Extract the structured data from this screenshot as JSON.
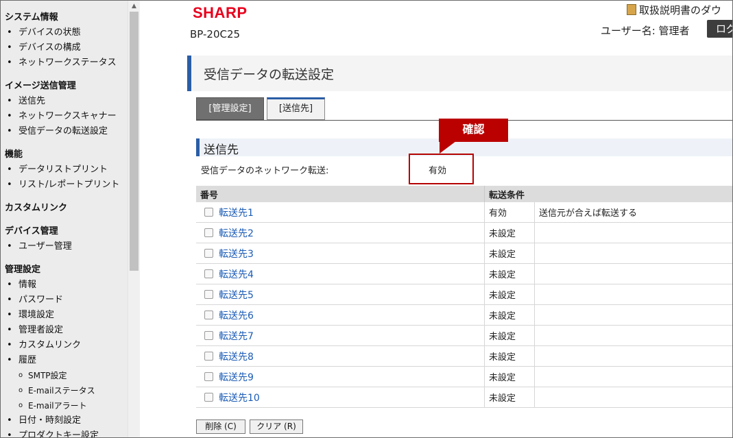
{
  "sidebar": {
    "sections": [
      {
        "title": "システム情報",
        "items": [
          {
            "label": "デバイスの状態"
          },
          {
            "label": "デバイスの構成"
          },
          {
            "label": "ネットワークステータス"
          }
        ]
      },
      {
        "title": "イメージ送信管理",
        "items": [
          {
            "label": "送信先"
          },
          {
            "label": "ネットワークスキャナー"
          },
          {
            "label": "受信データの転送設定"
          }
        ]
      },
      {
        "title": "機能",
        "items": [
          {
            "label": "データリストプリント"
          },
          {
            "label": "リスト/レポートプリント"
          }
        ]
      },
      {
        "title": "カスタムリンク",
        "items": []
      },
      {
        "title": "デバイス管理",
        "items": [
          {
            "label": "ユーザー管理"
          }
        ]
      },
      {
        "title": "管理設定",
        "items": [
          {
            "label": "情報"
          },
          {
            "label": "パスワード"
          },
          {
            "label": "環境設定"
          },
          {
            "label": "管理者設定"
          },
          {
            "label": "カスタムリンク"
          },
          {
            "label": "履歴"
          }
        ]
      }
    ],
    "history_subitems": [
      {
        "label": "SMTP設定"
      },
      {
        "label": "E-mailステータス"
      },
      {
        "label": "E-mailアラート"
      }
    ],
    "tail_items": [
      {
        "label": "日付・時刻設定"
      },
      {
        "label": "プロダクトキー設定"
      }
    ]
  },
  "header": {
    "logo": "SHARP",
    "model": "BP-20C25",
    "manual_link": "取扱説明書のダウ",
    "user_label": "ユーザー名: 管理者",
    "logout_label": "ログ"
  },
  "page_title": "受信データの転送設定",
  "tabs": {
    "admin": "[管理設定]",
    "destination": "[送信先]"
  },
  "section": {
    "title": "送信先",
    "network_transfer_label": "受信データのネットワーク転送:",
    "network_transfer_value": "有効"
  },
  "callout": "確認",
  "table": {
    "headers": {
      "number": "番号",
      "condition": "転送条件"
    },
    "rows": [
      {
        "name": "転送先1",
        "status": "有効",
        "condition": "送信元が合えば転送する"
      },
      {
        "name": "転送先2",
        "status": "未設定",
        "condition": ""
      },
      {
        "name": "転送先3",
        "status": "未設定",
        "condition": ""
      },
      {
        "name": "転送先4",
        "status": "未設定",
        "condition": ""
      },
      {
        "name": "転送先5",
        "status": "未設定",
        "condition": ""
      },
      {
        "name": "転送先6",
        "status": "未設定",
        "condition": ""
      },
      {
        "name": "転送先7",
        "status": "未設定",
        "condition": ""
      },
      {
        "name": "転送先8",
        "status": "未設定",
        "condition": ""
      },
      {
        "name": "転送先9",
        "status": "未設定",
        "condition": ""
      },
      {
        "name": "転送先10",
        "status": "未設定",
        "condition": ""
      }
    ]
  },
  "buttons": {
    "delete": "削除 (C)",
    "clear": "クリア (R)"
  },
  "colors": {
    "brand": "#e8001c",
    "accent": "#2a5da6",
    "callout": "#bb0000"
  }
}
